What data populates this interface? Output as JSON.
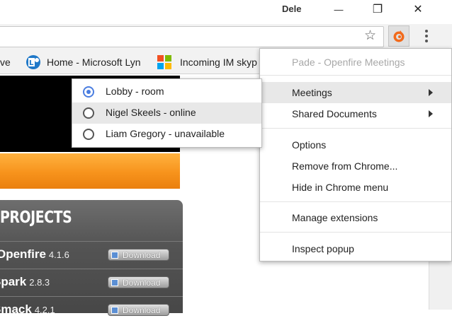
{
  "window": {
    "user_name": "Dele",
    "minimize_glyph": "—",
    "restore_glyph": "❐",
    "close_glyph": "✕"
  },
  "toolbar": {
    "star_glyph": "☆",
    "extension_icon": "pade-extension-icon",
    "menu_icon": "kebab-menu-icon"
  },
  "bookmarks": [
    {
      "label": "ve",
      "icon": ""
    },
    {
      "label": "Home - Microsoft Lyn",
      "icon": "lync-icon"
    },
    {
      "label": "Incoming IM skyp",
      "icon": "windows-logo-icon"
    }
  ],
  "page": {
    "projects_title": "PROJECTS",
    "projects": [
      {
        "name": "Openfire",
        "version": "4.1.6",
        "download_label": "Download"
      },
      {
        "name": "Spark",
        "version": "2.8.3",
        "download_label": "Download"
      },
      {
        "name": "Smack",
        "version": "4.2.1",
        "download_label": "Download"
      }
    ]
  },
  "context_menu": {
    "header": "Pade - Openfire Meetings",
    "groups": [
      [
        {
          "label": "Meetings",
          "submenu": true,
          "highlighted": true
        },
        {
          "label": "Shared Documents",
          "submenu": true,
          "highlighted": false
        }
      ],
      [
        {
          "label": "Options"
        },
        {
          "label": "Remove from Chrome..."
        },
        {
          "label": "Hide in Chrome menu"
        }
      ],
      [
        {
          "label": "Manage extensions"
        }
      ],
      [
        {
          "label": "Inspect popup"
        }
      ]
    ]
  },
  "submenu": {
    "items": [
      {
        "label": "Lobby - room",
        "checked": true,
        "highlighted": false
      },
      {
        "label": "Nigel Skeels - online",
        "checked": false,
        "highlighted": true
      },
      {
        "label": "Liam Gregory - unavailable",
        "checked": false,
        "highlighted": false
      }
    ]
  },
  "colors": {
    "accent_radio": "#4a7de0",
    "orange_bar": "#f7931c",
    "extension_orange": "#f26a1b"
  }
}
